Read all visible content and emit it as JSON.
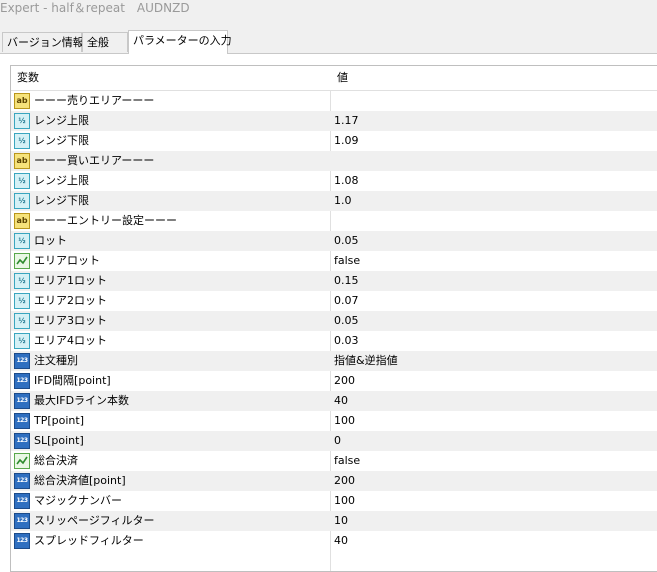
{
  "window": {
    "title": "Expert - half＆repeat　AUDNZD"
  },
  "tabs": [
    {
      "label": "バージョン情報",
      "active": false
    },
    {
      "label": "全般",
      "active": false
    },
    {
      "label": "パラメーターの入力",
      "active": true
    }
  ],
  "grid": {
    "headers": {
      "name": "変数",
      "value": "値"
    },
    "rows": [
      {
        "icon": "string-icon",
        "name": "ーーー売りエリアーーー",
        "value": ""
      },
      {
        "icon": "double-icon",
        "name": "レンジ上限",
        "value": "1.17"
      },
      {
        "icon": "double-icon",
        "name": "レンジ下限",
        "value": "1.09"
      },
      {
        "icon": "string-icon",
        "name": "ーーー買いエリアーーー",
        "value": ""
      },
      {
        "icon": "double-icon",
        "name": "レンジ上限",
        "value": "1.08"
      },
      {
        "icon": "double-icon",
        "name": "レンジ下限",
        "value": "1.0"
      },
      {
        "icon": "string-icon",
        "name": "ーーーエントリー設定ーーー",
        "value": ""
      },
      {
        "icon": "double-icon",
        "name": "ロット",
        "value": "0.05"
      },
      {
        "icon": "bool-icon",
        "name": "エリアロット",
        "value": "false"
      },
      {
        "icon": "double-icon",
        "name": "エリア1ロット",
        "value": "0.15"
      },
      {
        "icon": "double-icon",
        "name": "エリア2ロット",
        "value": "0.07"
      },
      {
        "icon": "double-icon",
        "name": "エリア3ロット",
        "value": "0.05"
      },
      {
        "icon": "double-icon",
        "name": "エリア4ロット",
        "value": "0.03"
      },
      {
        "icon": "int-icon",
        "name": "注文種別",
        "value": "指値&逆指値"
      },
      {
        "icon": "int-icon",
        "name": "IFD間隔[point]",
        "value": "200"
      },
      {
        "icon": "int-icon",
        "name": "最大IFDライン本数",
        "value": "40"
      },
      {
        "icon": "int-icon",
        "name": "TP[point]",
        "value": "100"
      },
      {
        "icon": "int-icon",
        "name": "SL[point]",
        "value": "0"
      },
      {
        "icon": "bool-icon",
        "name": "総合決済",
        "value": "false"
      },
      {
        "icon": "int-icon",
        "name": "総合決済値[point]",
        "value": "200"
      },
      {
        "icon": "int-icon",
        "name": "マジックナンバー",
        "value": "100"
      },
      {
        "icon": "int-icon",
        "name": "スリッページフィルター",
        "value": "10"
      },
      {
        "icon": "int-icon",
        "name": "スプレッドフィルター",
        "value": "40"
      }
    ]
  },
  "icon_text": {
    "string": "ab",
    "double": "½",
    "int": "123"
  },
  "colors": {
    "row_alt": "#f0f0f0",
    "grid_border": "#bfbfbf"
  }
}
